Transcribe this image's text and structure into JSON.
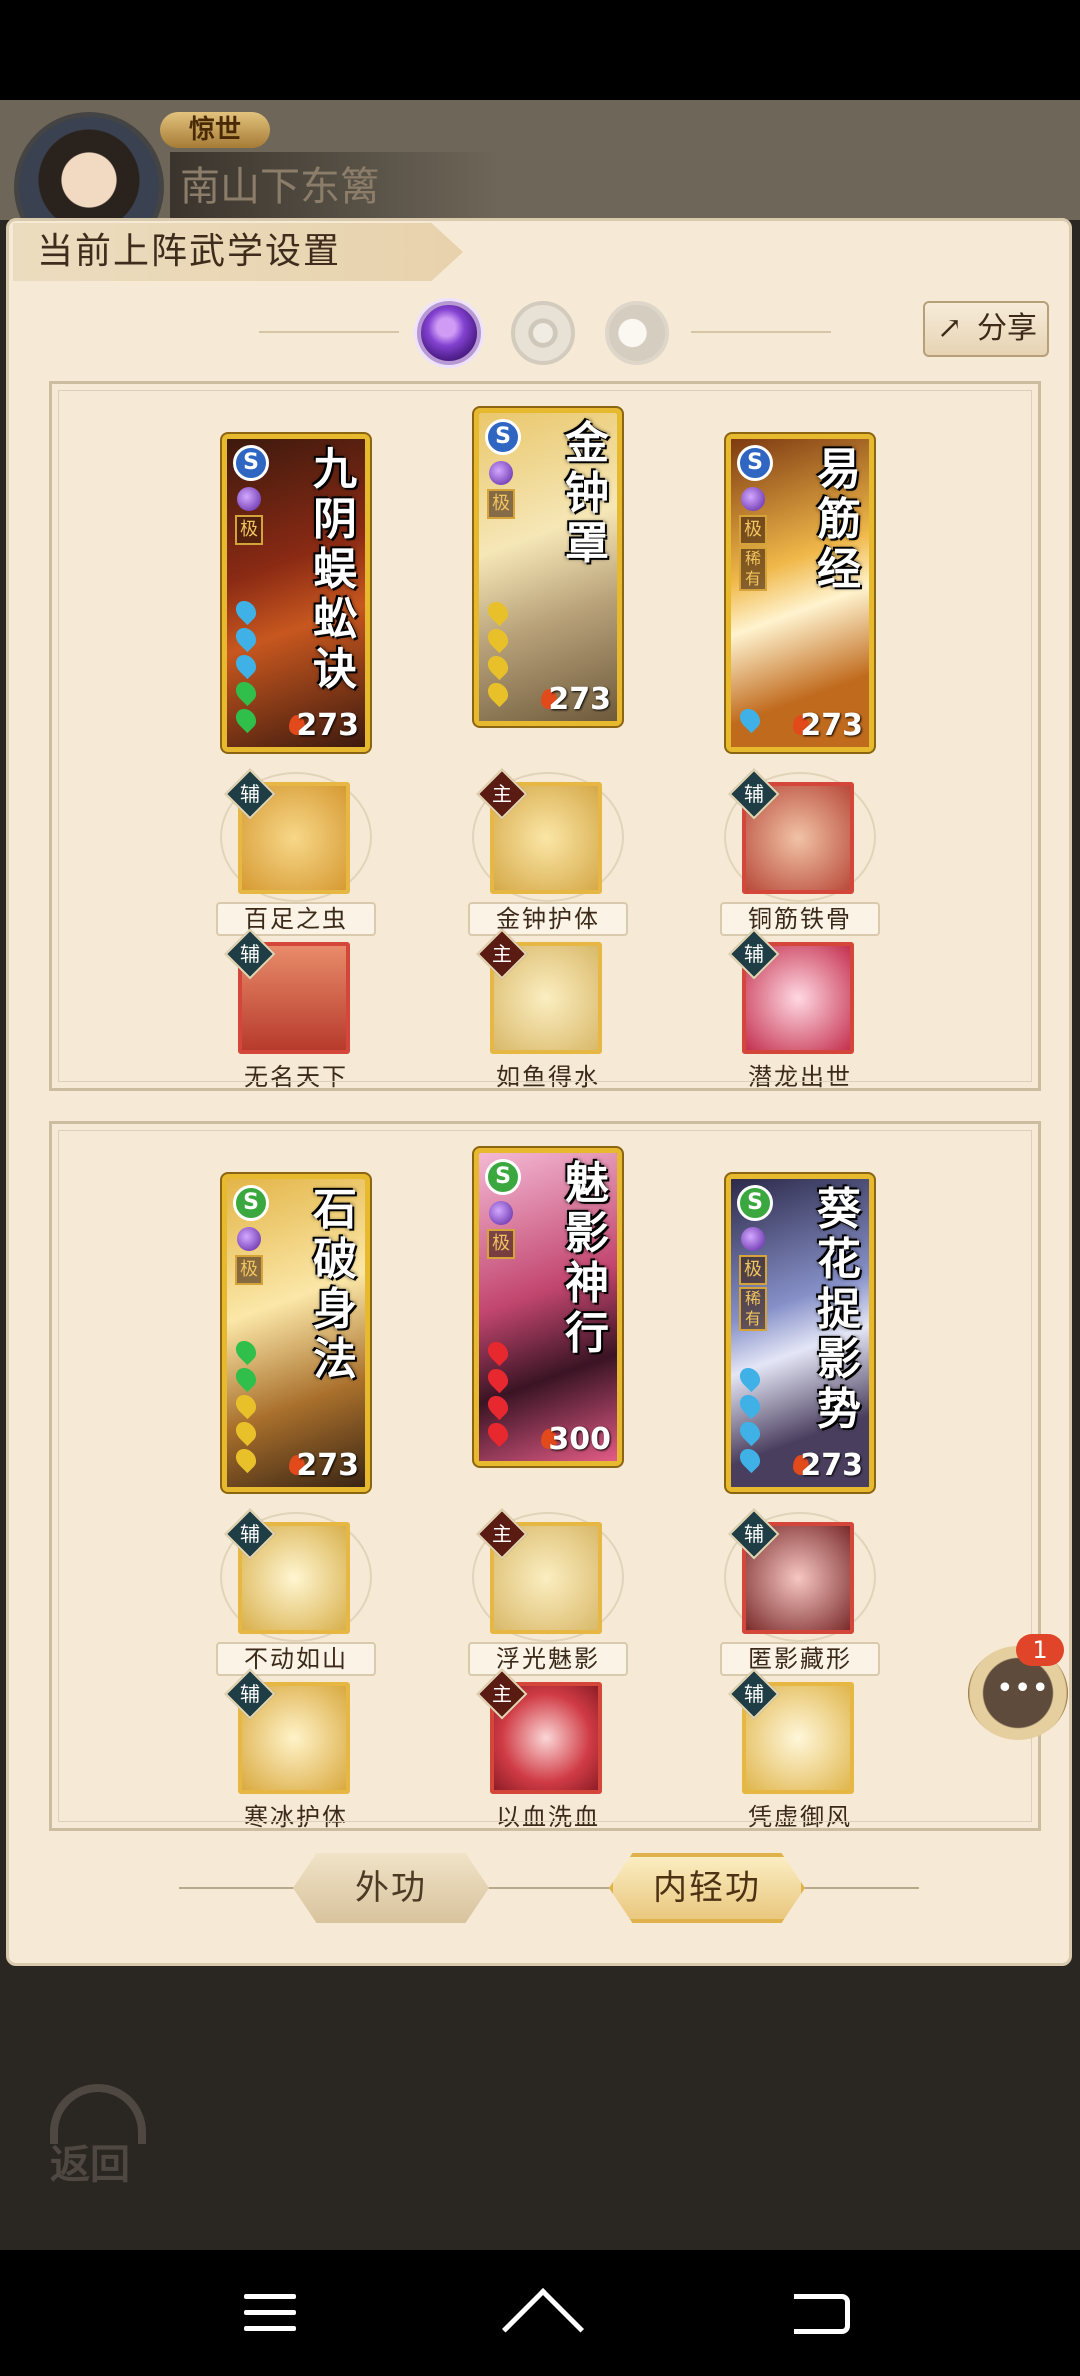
{
  "profile": {
    "title_badge": "惊世",
    "player_name": "南山下东篱"
  },
  "panel": {
    "title": "当前上阵武学设置",
    "share_label": "分享"
  },
  "realms": [
    {
      "name": "moon-purple-icon",
      "active": true
    },
    {
      "name": "sun-icon",
      "active": false
    },
    {
      "name": "moon-icon",
      "active": false
    }
  ],
  "groups": [
    {
      "cards": [
        {
          "name": "九阴蜈蚣诀",
          "power": "273",
          "school": "S",
          "grade": "极",
          "rare": ""
        },
        {
          "name": "金钟罩",
          "power": "273",
          "school": "S",
          "grade": "极",
          "rare": ""
        },
        {
          "name": "易筋经",
          "power": "273",
          "school": "S",
          "grade": "极",
          "rare": "稀有"
        }
      ],
      "skills_row1": [
        {
          "tag": "辅",
          "label": "百足之虫"
        },
        {
          "tag": "主",
          "label": "金钟护体"
        },
        {
          "tag": "辅",
          "label": "铜筋铁骨"
        }
      ],
      "skills_row2": [
        {
          "tag": "辅",
          "label": "无名天下"
        },
        {
          "tag": "主",
          "label": "如鱼得水"
        },
        {
          "tag": "辅",
          "label": "潜龙出世"
        }
      ]
    },
    {
      "cards": [
        {
          "name": "石破身法",
          "power": "273",
          "school": "S",
          "grade": "极",
          "rare": ""
        },
        {
          "name": "魅影神行",
          "power": "300",
          "school": "S",
          "grade": "极",
          "rare": ""
        },
        {
          "name": "葵花捉影势",
          "power": "273",
          "school": "S",
          "grade": "极",
          "rare": "稀有"
        }
      ],
      "skills_row1": [
        {
          "tag": "辅",
          "label": "不动如山"
        },
        {
          "tag": "主",
          "label": "浮光魅影"
        },
        {
          "tag": "辅",
          "label": "匿影藏形"
        }
      ],
      "skills_row2": [
        {
          "tag": "辅",
          "label": "寒冰护体"
        },
        {
          "tag": "主",
          "label": "以血洗血"
        },
        {
          "tag": "辅",
          "label": "凭虚御风"
        }
      ]
    }
  ],
  "bottom_tabs": {
    "outer": "外功",
    "inner": "内轻功"
  },
  "chat": {
    "badge": "1"
  },
  "back_label": "返回",
  "colors": {
    "panel_bg": "#f6ead6",
    "card_border": "#e7b92e",
    "accent_purple": "#8342d1"
  }
}
